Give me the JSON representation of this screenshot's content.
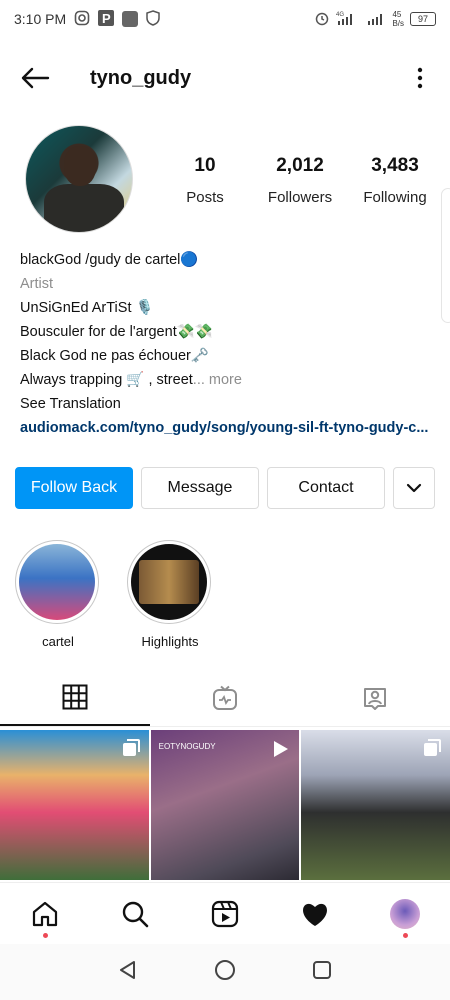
{
  "status": {
    "time": "3:10 PM",
    "network_top": "4G",
    "speed_value": "45",
    "speed_unit": "B/s",
    "battery": "97"
  },
  "header": {
    "username": "tyno_gudy"
  },
  "stats": {
    "posts": {
      "count": "10",
      "label": "Posts"
    },
    "followers": {
      "count": "2,012",
      "label": "Followers"
    },
    "following": {
      "count": "3,483",
      "label": "Following"
    }
  },
  "bio": {
    "name": "blackGod /gudy de cartel🔵",
    "category": "Artist",
    "line1": "UnSiGnEd ArTiSt 🎙️",
    "line2": "Bousculer for de l'argent💸💸",
    "line3": "Black God ne pas échouer🗝️",
    "line4": "Always trapping 🛒 , street",
    "more": "... more",
    "translate": "See Translation",
    "link": "audiomack.com/tyno_gudy/song/young-sil-ft-tyno-gudy-c..."
  },
  "actions": {
    "follow_back": "Follow Back",
    "message": "Message",
    "contact": "Contact"
  },
  "highlights": [
    {
      "label": "cartel"
    },
    {
      "label": "Highlights"
    }
  ],
  "posts": [
    {
      "type": "carousel"
    },
    {
      "type": "video",
      "overlay_text": "EOTYNOGUDY"
    },
    {
      "type": "carousel"
    }
  ],
  "colors": {
    "primary": "#0095f6",
    "link": "#00376b",
    "notification_dot": "#ed4956"
  }
}
